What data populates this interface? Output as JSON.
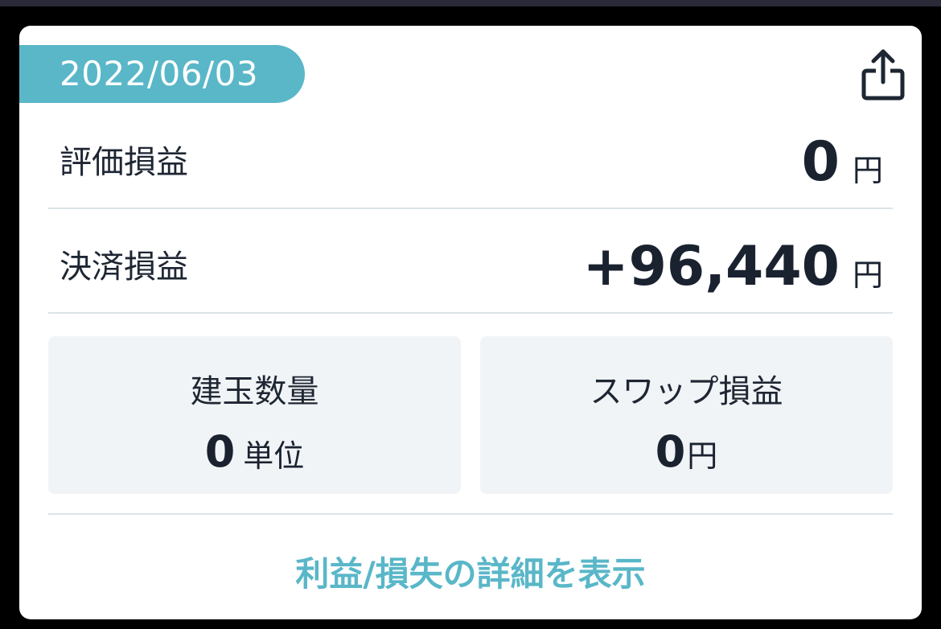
{
  "date": "2022/06/03",
  "share": {
    "icon": "share-icon"
  },
  "valuation": {
    "label": "評価損益",
    "value": "0",
    "unit": "円"
  },
  "settlement": {
    "label": "決済損益",
    "value": "+96,440",
    "unit": "円"
  },
  "position": {
    "label": "建玉数量",
    "value": "0",
    "unit": "単位"
  },
  "swap": {
    "label": "スワップ損益",
    "value": "0",
    "unit": "円"
  },
  "details_link": "利益/損失の詳細を表示",
  "colors": {
    "accent": "#59b7c8",
    "text": "#1a2230",
    "tile_bg": "#f1f4f6",
    "divider": "#dde3e8"
  }
}
